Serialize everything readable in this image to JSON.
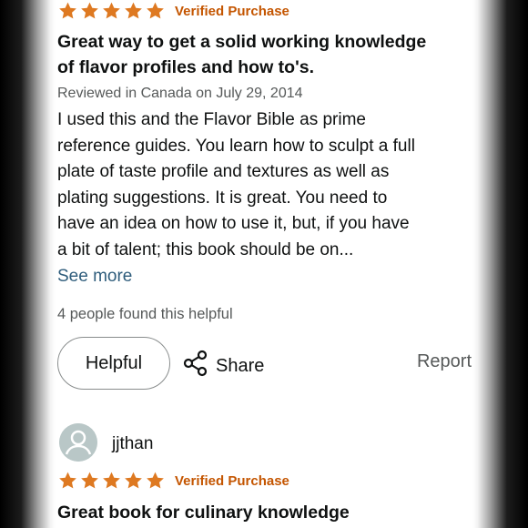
{
  "review1": {
    "verified": "Verified Purchase",
    "title_line1": "Great way to get a solid working knowledge",
    "title_line2": "of flavor profiles and how to's.",
    "meta": "Reviewed in Canada on July 29, 2014",
    "body_lines": [
      "I used this and the Flavor Bible as prime",
      "reference guides. You learn how to sculpt a full",
      "plate of taste profile and textures as well as",
      "plating suggestions. It is great. You need to",
      "have an idea on how to use it, but, if you have",
      "a bit of talent; this book should be on..."
    ],
    "see_more": "See more",
    "helpful_count": "4 people found this helpful",
    "helpful_button": "Helpful",
    "share": "Share",
    "report": "Report",
    "rating": 5
  },
  "review2": {
    "username": "jjthan",
    "verified": "Verified Purchase",
    "title": "Great book for culinary knowledge",
    "rating": 5
  },
  "colors": {
    "star": "#de7921",
    "verified": "#c45500",
    "link": "#2f5d7c",
    "secondary_text": "#565959"
  },
  "icons": {
    "star": "star-icon",
    "share": "share-icon",
    "avatar": "user-avatar-icon"
  }
}
